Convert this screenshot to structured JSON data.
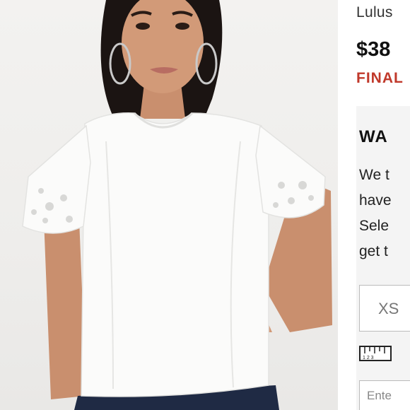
{
  "product": {
    "brand": "Lulus",
    "price": "$38",
    "sale_status": "FINAL"
  },
  "panel": {
    "title": "WA",
    "lines": [
      "We t",
      "have",
      "Sele",
      "get t"
    ],
    "size_option": "XS",
    "ruler_icon": "ruler-icon",
    "email_placeholder": "Ente"
  },
  "colors": {
    "final_red": "#c0392b",
    "panel_bg": "#f4f4f4",
    "photo_bg": "#f0efed"
  }
}
